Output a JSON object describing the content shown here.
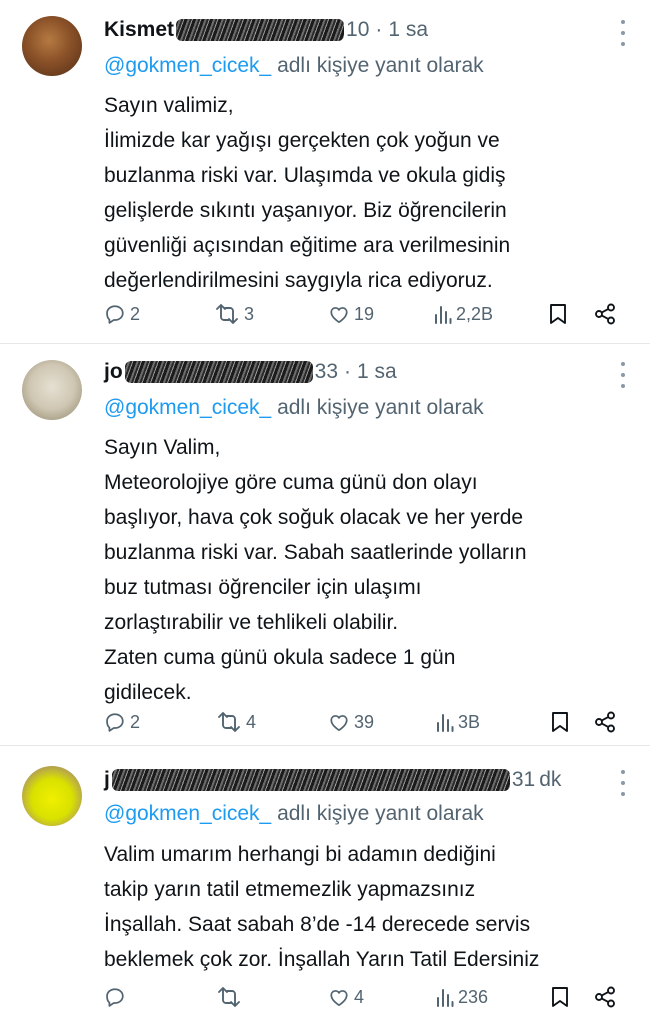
{
  "reply_prefix_label": "adlı kişiye yanıt olarak",
  "tweets": [
    {
      "name_visible": "Kismet",
      "handle_tail": "10",
      "time": "1 sa",
      "reply_to": "@gokmen_cicek_",
      "lines": [
        "Sayın valimiz,",
        "İlimizde kar yağışı gerçekten çok yoğun ve",
        "buzlanma riski var. Ulaşımda ve okula gidiş",
        "gelişlerde sıkıntı yaşanıyor. Biz öğrencilerin",
        "güvenliği açısından eğitime ara verilmesinin",
        "değerlendirilmesini saygıyla rica ediyoruz."
      ],
      "replies": "2",
      "reposts": "3",
      "likes": "19",
      "views": "2,2B"
    },
    {
      "name_visible": "jo",
      "handle_tail": "33",
      "time": "1 sa",
      "reply_to": "@gokmen_cicek_",
      "lines": [
        "Sayın Valim,",
        "Meteorolojiye göre cuma günü don olayı",
        "başlıyor, hava çok soğuk olacak ve her yerde",
        "buzlanma riski var. Sabah saatlerinde yolların",
        "buz tutması öğrenciler için ulaşımı",
        "zorlaştırabilir ve tehlikeli olabilir.",
        "Zaten cuma günü okula sadece 1 gün",
        "gidilecek."
      ],
      "replies": "2",
      "reposts": "4",
      "likes": "39",
      "views": "3B"
    },
    {
      "name_visible": "j",
      "handle_tail": "31",
      "time": "dk",
      "reply_to": "@gokmen_cicek_",
      "lines": [
        "Valim umarım herhangi bi adamın dediğini",
        "takip yarın tatil etmemezlik yapmazsınız",
        "İnşallah. Saat sabah 8’de -14 derecede servis",
        "beklemek çok zor. İnşallah Yarın Tatil Edersiniz"
      ],
      "replies": "",
      "reposts": "",
      "likes": "4",
      "views": "236"
    }
  ],
  "colors": {
    "text": "#0f1419",
    "secondary": "#536471",
    "link": "#1d9bf0",
    "divider": "#e6e8ea"
  },
  "icons": [
    "reply-icon",
    "repost-icon",
    "like-icon",
    "views-icon",
    "bookmark-icon",
    "share-icon",
    "more-icon"
  ]
}
